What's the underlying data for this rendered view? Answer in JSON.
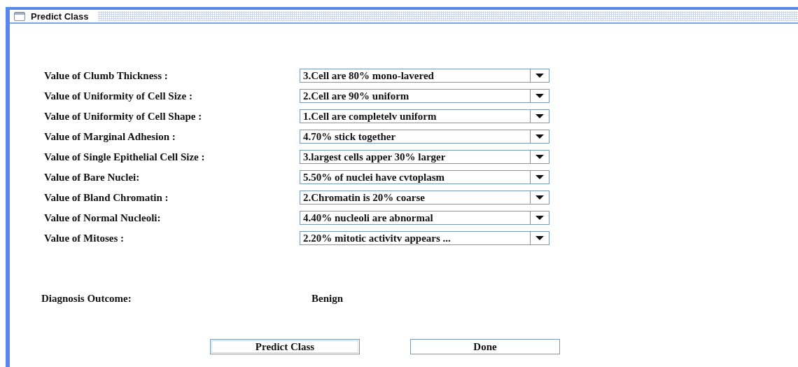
{
  "window": {
    "title": "Predict Class"
  },
  "fields": [
    {
      "label": "Value of Clumb Thickness :",
      "value": "3.Cell are 80% mono-lavered"
    },
    {
      "label": "Value of Uniformity of Cell Size :",
      "value": "2.Cell are 90% uniform"
    },
    {
      "label": "Value of Uniformity of Cell Shape :",
      "value": "1.Cell are completelv uniform"
    },
    {
      "label": "Value of Marginal Adhesion :",
      "value": "4.70% stick together"
    },
    {
      "label": "Value of Single Epithelial Cell Size :",
      "value": "3.largest cells apper 30% larger"
    },
    {
      "label": "Value of Bare Nuclei:",
      "value": "5.50% of nuclei have cvtoplasm"
    },
    {
      "label": "Value of Bland Chromatin :",
      "value": "2.Chromatin is 20% coarse"
    },
    {
      "label": "Value of Normal Nucleoli:",
      "value": "4.40% nucleoli are abnormal"
    },
    {
      "label": "Value of Mitoses :",
      "value": "2.20% mitotic activitv appears ..."
    }
  ],
  "outcome": {
    "label": "Diagnosis Outcome:",
    "value": "Benign"
  },
  "buttons": [
    {
      "label": "Predict Class",
      "focused": true
    },
    {
      "label": "Done",
      "focused": false
    }
  ]
}
